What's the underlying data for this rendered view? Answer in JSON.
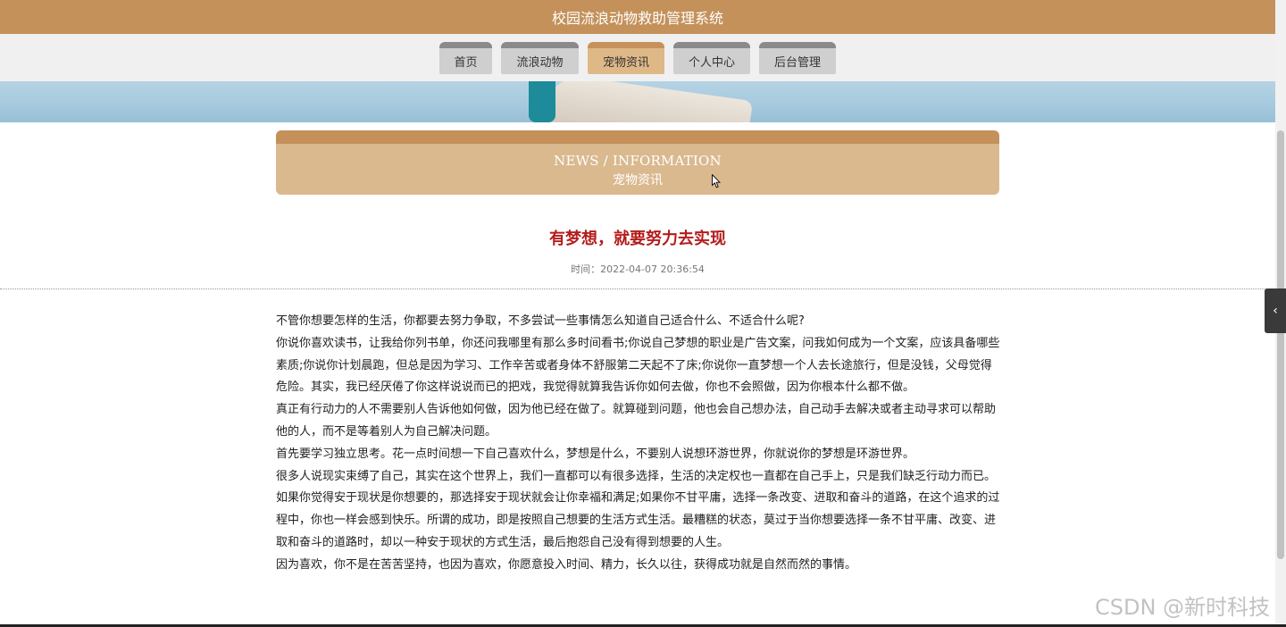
{
  "header": {
    "title": "校园流浪动物救助管理系统"
  },
  "nav": {
    "tabs": [
      {
        "label": "首页",
        "active": false
      },
      {
        "label": "流浪动物",
        "active": false
      },
      {
        "label": "宠物资讯",
        "active": true
      },
      {
        "label": "个人中心",
        "active": false
      },
      {
        "label": "后台管理",
        "active": false
      }
    ]
  },
  "section": {
    "en_title": "NEWS / INFORMATION",
    "cn_title": "宠物资讯"
  },
  "article": {
    "title": "有梦想，就要努力去实现",
    "time_label": "时间：",
    "time_value": "2022-04-07 20:36:54",
    "paragraphs": [
      "不管你想要怎样的生活，你都要去努力争取，不多尝试一些事情怎么知道自己适合什么、不适合什么呢?",
      "你说你喜欢读书，让我给你列书单，你还问我哪里有那么多时间看书;你说自己梦想的职业是广告文案，问我如何成为一个文案，应该具备哪些素质;你说你计划晨跑，但总是因为学习、工作辛苦或者身体不舒服第二天起不了床;你说你一直梦想一个人去长途旅行，但是没钱，父母觉得危险。其实，我已经厌倦了你这样说说而已的把戏，我觉得就算我告诉你如何去做，你也不会照做，因为你根本什么都不做。",
      "真正有行动力的人不需要别人告诉他如何做，因为他已经在做了。就算碰到问题，他也会自己想办法，自己动手去解决或者主动寻求可以帮助他的人，而不是等着别人为自己解决问题。",
      "首先要学习独立思考。花一点时间想一下自己喜欢什么，梦想是什么，不要别人说想环游世界，你就说你的梦想是环游世界。",
      "很多人说现实束缚了自己，其实在这个世界上，我们一直都可以有很多选择，生活的决定权也一直都在自己手上，只是我们缺乏行动力而已。",
      "如果你觉得安于现状是你想要的，那选择安于现状就会让你幸福和满足;如果你不甘平庸，选择一条改变、进取和奋斗的道路，在这个追求的过程中，你也一样会感到快乐。所谓的成功，即是按照自己想要的生活方式生活。最糟糕的状态，莫过于当你想要选择一条不甘平庸、改变、进取和奋斗的道路时，却以一种安于现状的方式生活，最后抱怨自己没有得到想要的人生。",
      "因为喜欢，你不是在苦苦坚持，也因为喜欢，你愿意投入时间、精力，长久以往，获得成功就是自然而然的事情。"
    ]
  },
  "watermark": "CSDN @新时科技",
  "icons": {
    "side_toggle": "chevron-left-icon",
    "cursor": "mouse-pointer-icon"
  },
  "colors": {
    "brand": "#c4915b",
    "title_red": "#b51c1c",
    "active_tab": "#deb887"
  }
}
